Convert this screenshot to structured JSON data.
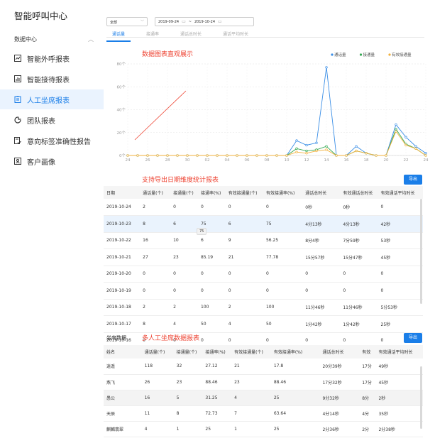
{
  "app": {
    "title": "智能呼叫中心"
  },
  "sidebar": {
    "group_label": "数据中心",
    "items": [
      {
        "label": "智能外呼报表",
        "icon": "chart-trend-icon",
        "active": false
      },
      {
        "label": "智能接待报表",
        "icon": "bar-chart-icon",
        "active": false
      },
      {
        "label": "人工坐席报表",
        "icon": "clipboard-icon",
        "active": true
      },
      {
        "label": "团队报表",
        "icon": "pie-chart-icon",
        "active": false
      },
      {
        "label": "意向标签准确性报告",
        "icon": "document-check-icon",
        "active": false
      },
      {
        "label": "客户画像",
        "icon": "user-card-icon",
        "active": false
      }
    ]
  },
  "filters": {
    "select_value": "全部",
    "date_start": "2019-09-24",
    "date_sep": "~",
    "date_end": "2019-10-24"
  },
  "tabs": [
    "通话量",
    "接通率",
    "通话总时长",
    "通话平均时长"
  ],
  "annotations": {
    "chart": "数据图表直观展示",
    "export": "支持导出日期维度统计报表",
    "multi": "多人工坐席数据报表"
  },
  "export_label": "导出",
  "chart_data": {
    "type": "line",
    "x": [
      "24",
      "25",
      "26",
      "27",
      "28",
      "29",
      "30",
      "01",
      "02",
      "03",
      "04",
      "05",
      "06",
      "07",
      "08",
      "09",
      "10",
      "11",
      "12",
      "13",
      "14",
      "15",
      "16",
      "17",
      "18",
      "19",
      "20",
      "21",
      "22",
      "23",
      "24"
    ],
    "x_ticks": [
      "24",
      "26",
      "28",
      "30",
      "02",
      "04",
      "06",
      "08",
      "10",
      "12",
      "14",
      "16",
      "18",
      "20",
      "22",
      "24"
    ],
    "ylim": [
      0,
      80
    ],
    "y_ticks": [
      "0个",
      "20个",
      "40个",
      "60个",
      "80个"
    ],
    "legend": [
      "通话量",
      "接通量",
      "有效接通量"
    ],
    "colors": [
      "#3a8ee6",
      "#34a853",
      "#f2b13c"
    ],
    "series": [
      {
        "name": "通话量",
        "values": [
          0,
          0,
          0,
          0,
          0,
          0,
          0,
          0,
          0,
          0,
          0,
          0,
          0,
          0,
          0,
          0,
          0,
          13,
          9,
          11,
          77,
          0,
          0,
          8,
          2,
          0,
          0,
          27,
          16,
          8,
          2
        ]
      },
      {
        "name": "接通量",
        "values": [
          0,
          0,
          0,
          0,
          0,
          0,
          0,
          0,
          0,
          0,
          0,
          0,
          0,
          0,
          0,
          0,
          0,
          6,
          4,
          5,
          8,
          0,
          0,
          4,
          2,
          0,
          0,
          23,
          10,
          6,
          0
        ]
      },
      {
        "name": "有效接通量",
        "values": [
          0,
          0,
          0,
          0,
          0,
          0,
          0,
          0,
          0,
          0,
          0,
          0,
          0,
          0,
          0,
          0,
          0,
          3,
          2,
          4,
          5,
          0,
          0,
          4,
          2,
          0,
          0,
          21,
          9,
          6,
          0
        ]
      }
    ]
  },
  "daily_table": {
    "headers": [
      "日期",
      "通话量(个)",
      "接通量(个)",
      "接通率(%)",
      "有效接通量(个)",
      "有效接通率(%)",
      "通话总时长",
      "有效通话总时长",
      "有效通话平均时长"
    ],
    "rows": [
      [
        "2019-10-24",
        "2",
        "0",
        "0",
        "0",
        "0",
        "0秒",
        "0秒",
        "0"
      ],
      [
        "2019-10-23",
        "8",
        "6",
        "75",
        "6",
        "75",
        "4分13秒",
        "4分13秒",
        "42秒"
      ],
      [
        "2019-10-22",
        "16",
        "10",
        "6",
        "9",
        "56.25",
        "8分4秒",
        "7分59秒",
        "53秒"
      ],
      [
        "2019-10-21",
        "27",
        "23",
        "85.19",
        "21",
        "77.78",
        "15分57秒",
        "15分47秒",
        "45秒"
      ],
      [
        "2019-10-20",
        "0",
        "0",
        "0",
        "0",
        "0",
        "0",
        "0",
        "0"
      ],
      [
        "2019-10-19",
        "0",
        "0",
        "0",
        "0",
        "0",
        "0",
        "0",
        "0"
      ],
      [
        "2019-10-18",
        "2",
        "2",
        "100",
        "2",
        "100",
        "11分46秒",
        "11分46秒",
        "5分53秒"
      ],
      [
        "2019-10-17",
        "8",
        "4",
        "50",
        "4",
        "50",
        "1分42秒",
        "1分42秒",
        "25秒"
      ],
      [
        "2019-10-16",
        "0",
        "0",
        "0",
        "0",
        "0",
        "0",
        "0",
        "0"
      ]
    ],
    "tooltip": "75"
  },
  "agent_table": {
    "title": "坐席数据",
    "headers": [
      "姓名",
      "通话量(个)",
      "接通量(个)",
      "接通率(%)",
      "有效接通量(个)",
      "有效接通率(%)",
      "通话总时长",
      "有效",
      "有效通话平均时长"
    ],
    "rows": [
      [
        "逍遥",
        "118",
        "32",
        "27.12",
        "21",
        "17.8",
        "20分39秒",
        "17分",
        "49秒"
      ],
      [
        "燕飞",
        "26",
        "23",
        "88.46",
        "23",
        "88.46",
        "17分32秒",
        "17分",
        "45秒"
      ],
      [
        "愚公",
        "16",
        "5",
        "31.25",
        "4",
        "25",
        "9分32秒",
        "8分",
        "2秒"
      ],
      [
        "天辰",
        "11",
        "8",
        "72.73",
        "7",
        "63.64",
        "4分14秒",
        "4分",
        "35秒"
      ],
      [
        "麒麟翡翠",
        "4",
        "1",
        "25",
        "1",
        "25",
        "2分36秒",
        "2分",
        "2分38秒"
      ]
    ]
  }
}
